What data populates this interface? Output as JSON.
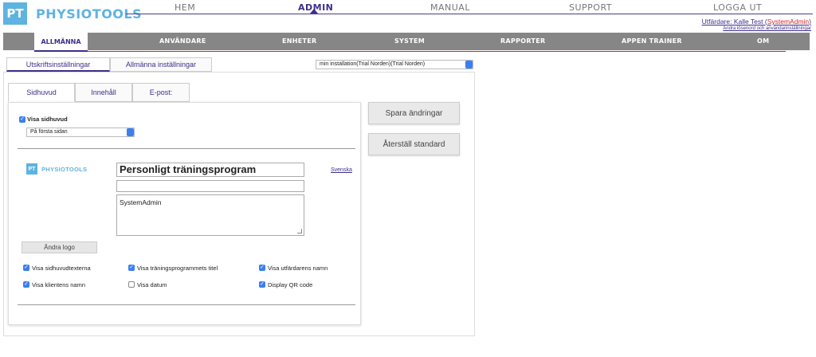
{
  "brand": {
    "logo_mark": "PT",
    "name": "PHYSIOTOOLS"
  },
  "top_nav": {
    "home": "HEM",
    "admin": "ADMIN",
    "manual": "MANUAL",
    "support": "SUPPORT",
    "logout": "LOGGA UT"
  },
  "user": {
    "issuer_prefix": "Utfärdare: Kalle Test (",
    "role": "SystemAdmin",
    "issuer_suffix": ")",
    "change_link": "Ändra lösenord och användarinställningar"
  },
  "admin_nav": {
    "general": "ALLMÄNNA",
    "users": "ANVÄNDARE",
    "units": "ENHETER",
    "system": "SYSTEM",
    "reports": "RAPPORTER",
    "trainer": "APPEN TRAINER",
    "about": "OM"
  },
  "sub_tabs": {
    "print": "Utskriftsinställningar",
    "general": "Allmänna inställningar"
  },
  "installation_select": "min installation(Trial Norden)(Trial Norden)",
  "inner_tabs": {
    "header": "Sidhuvud",
    "content": "Innehåll",
    "email": "E-post:"
  },
  "header_settings": {
    "show_header_label": "Visa sidhuvud",
    "page_option": "På första sidan"
  },
  "preview": {
    "logo_mark": "PT",
    "logo_name": "PHYSIOTOOLS",
    "title": "Personligt träningsprogram",
    "empty_line": "",
    "textarea": "SystemAdmin",
    "language_link": "Svenska",
    "change_logo": "Ändra logo"
  },
  "options": [
    {
      "label": "Visa sidhuvudtexterna",
      "checked": true
    },
    {
      "label": "Visa träningsprogrammets titel",
      "checked": true
    },
    {
      "label": "Visa utfärdarens namn",
      "checked": true
    },
    {
      "label": "Visa klientens namn",
      "checked": true
    },
    {
      "label": "Visa datum",
      "checked": false
    },
    {
      "label": "Display QR code",
      "checked": true
    }
  ],
  "actions": {
    "save": "Spara ändringar",
    "reset": "Återställ standard"
  },
  "colors": {
    "brand_blue": "#5fb3e0",
    "purple": "#3d2f8a",
    "accent_red": "#dd2222",
    "nav_gray": "#868686"
  }
}
